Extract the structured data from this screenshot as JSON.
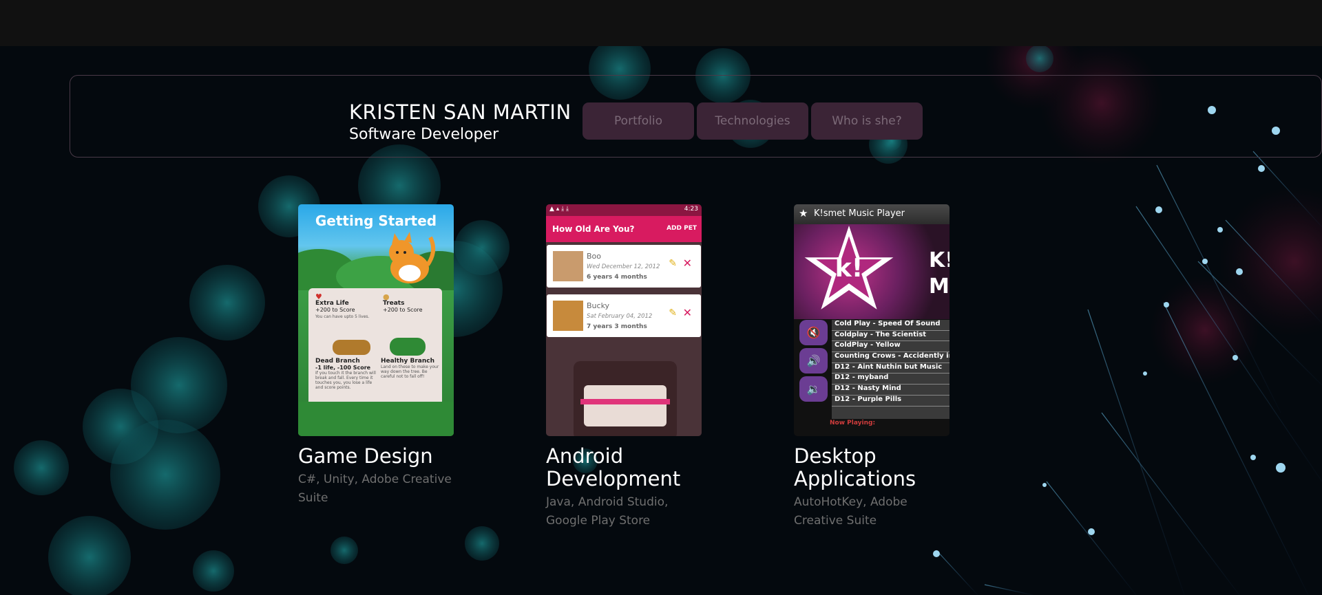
{
  "header": {
    "name": "KRISTEN SAN MARTIN",
    "role": "Software Developer"
  },
  "nav": [
    {
      "label": "Portfolio"
    },
    {
      "label": "Technologies"
    },
    {
      "label": "Who is she?"
    }
  ],
  "projects": [
    {
      "title": "Game Design",
      "tech": "C#, Unity, Adobe Creative Suite",
      "screenshot": {
        "heading": "Getting Started",
        "items": [
          {
            "name": "Extra Life",
            "score": "+200 to Score",
            "desc": "You can have upto 5 lives."
          },
          {
            "name": "Treats",
            "score": "+200 to Score",
            "desc": ""
          },
          {
            "name": "Dead Branch",
            "score": "-1 life, -100 Score",
            "desc": "If you touch it the branch will break and fall. Every time it touches you, you lose a life and score points."
          },
          {
            "name": "Healthy Branch",
            "score": "",
            "desc": "Land on these to make your way down the tree. Be careful not to fall off!"
          }
        ]
      }
    },
    {
      "title": "Android Development",
      "tech": "Java, Android Studio, Google Play Store",
      "screenshot": {
        "time": "4:23",
        "app_title": "How Old Are You?",
        "action": "ADD PET",
        "pets": [
          {
            "name": "Boo",
            "date": "Wed December 12, 2012",
            "age": "6 years 4 months"
          },
          {
            "name": "Bucky",
            "date": "Sat February 04, 2012",
            "age": "7 years 3 months"
          }
        ]
      }
    },
    {
      "title": "Desktop Applications",
      "tech": "AutoHotKey, Adobe Creative Suite",
      "screenshot": {
        "window_title": "K!smet Music Player",
        "brand_1": "K!",
        "brand_2": "Mu",
        "songs": [
          "Cold Play - Speed Of Sound",
          "Coldplay - The Scientist",
          "ColdPlay - Yellow",
          "Counting Crows - Accidently in Love",
          "D12 - Aint Nuthin but Music",
          "D12 - myband",
          "D12 - Nasty Mind",
          "D12 - Purple Pills"
        ],
        "now_playing": "Now Playing:"
      }
    }
  ]
}
